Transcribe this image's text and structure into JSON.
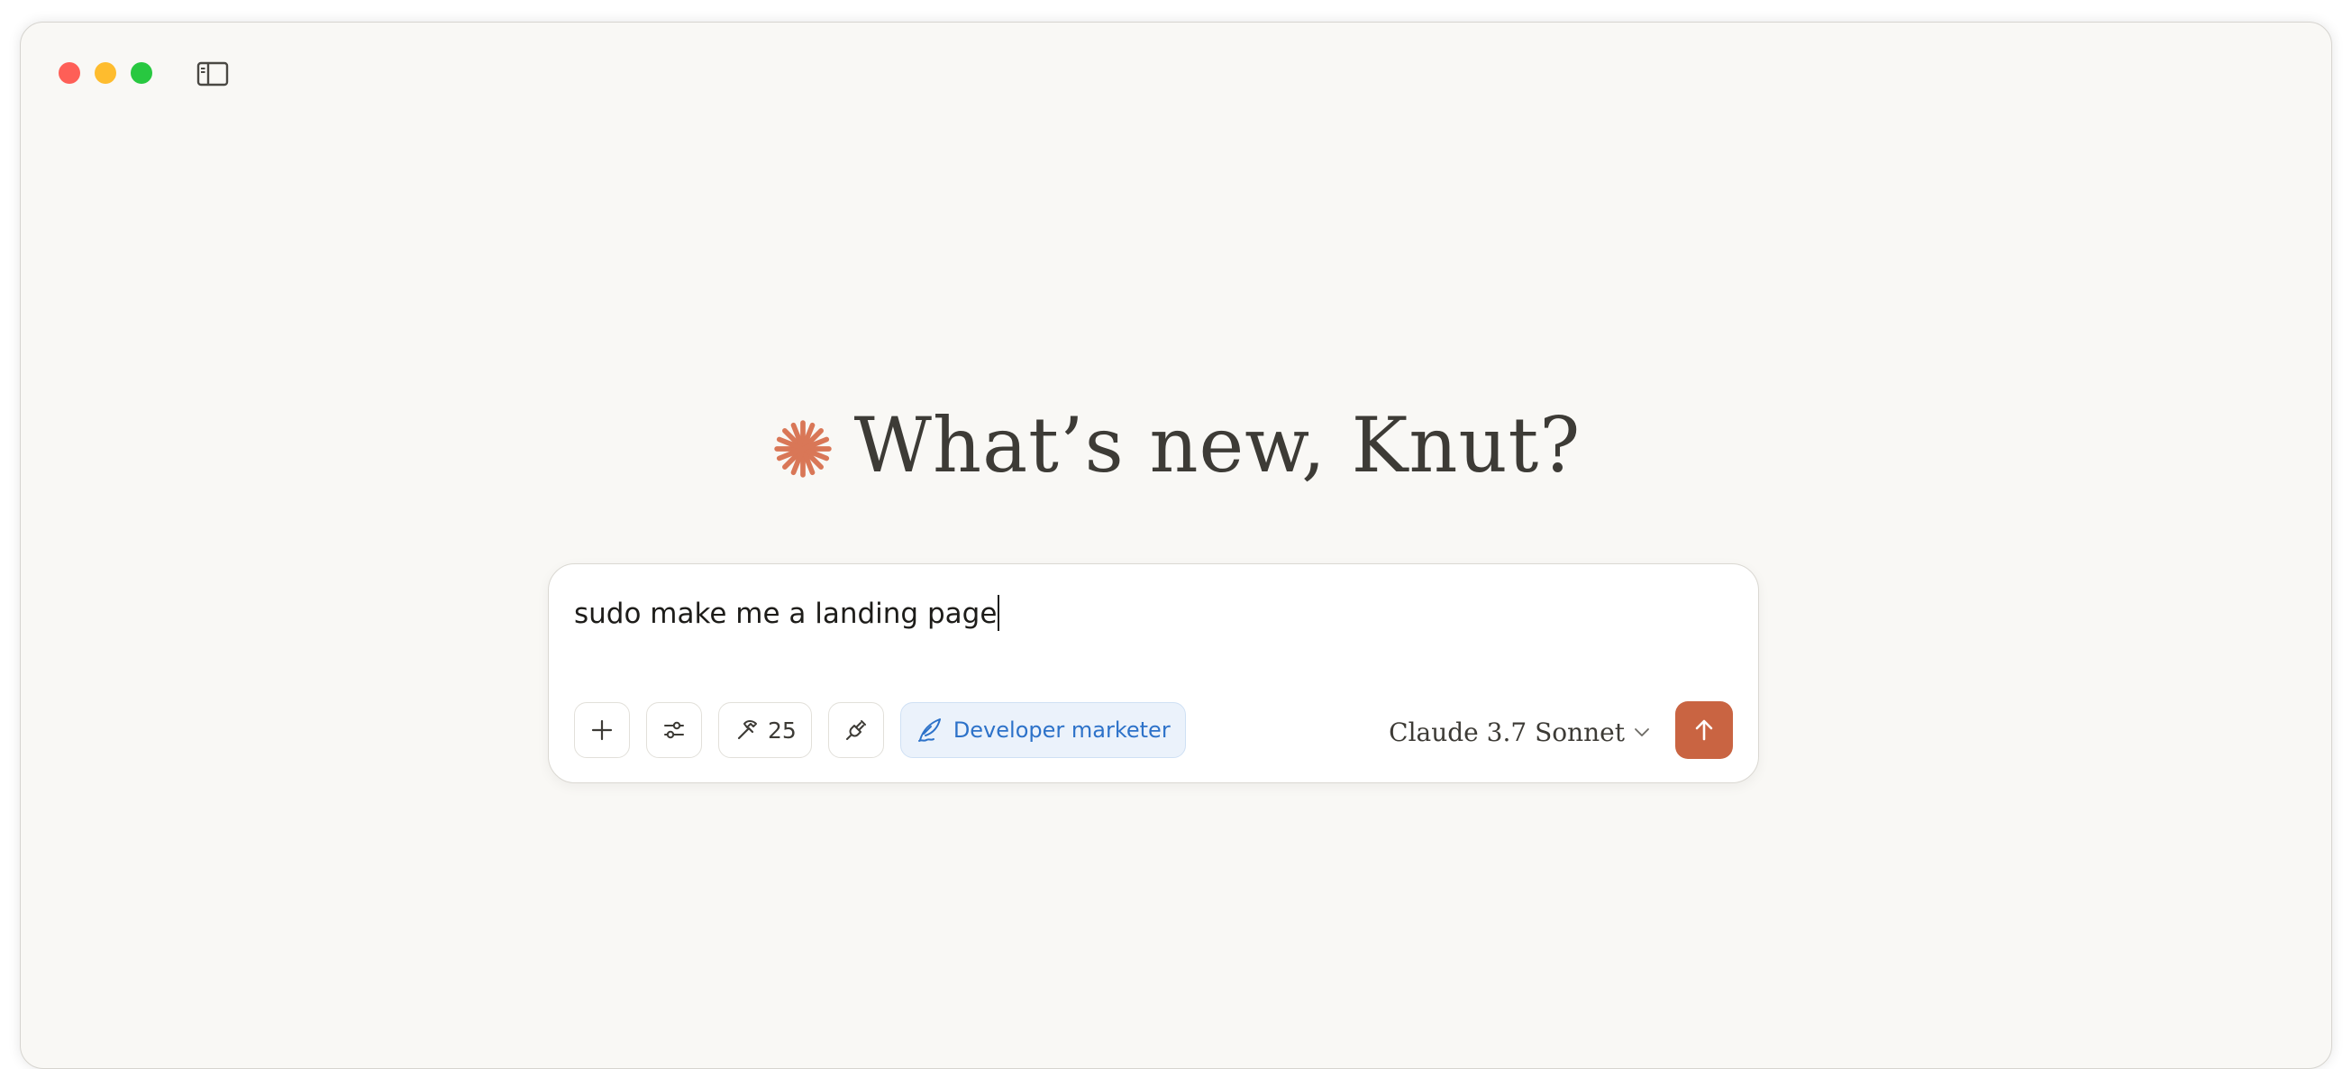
{
  "window": {
    "controls": [
      "close",
      "minimize",
      "zoom"
    ]
  },
  "header": {
    "sidebar_toggle_icon": "sidebar-icon"
  },
  "greeting": {
    "title": "What’s new, Knut?",
    "icon": "claude-star-icon",
    "icon_color": "#d97757"
  },
  "composer": {
    "input_value": "sudo make me a landing page",
    "toolbar": {
      "add_icon": "plus-icon",
      "settings_icon": "sliders-icon",
      "tools_icon": "hammer-icon",
      "tools_count": "25",
      "integrations_icon": "plug-icon",
      "style_icon": "quill-icon",
      "style_label": "Developer marketer",
      "style_color": "#2d72c9"
    },
    "model": {
      "label": "Claude 3.7 Sonnet",
      "icon": "chevron-down-icon"
    },
    "send": {
      "icon": "arrow-up-icon",
      "color": "#c96442"
    }
  }
}
